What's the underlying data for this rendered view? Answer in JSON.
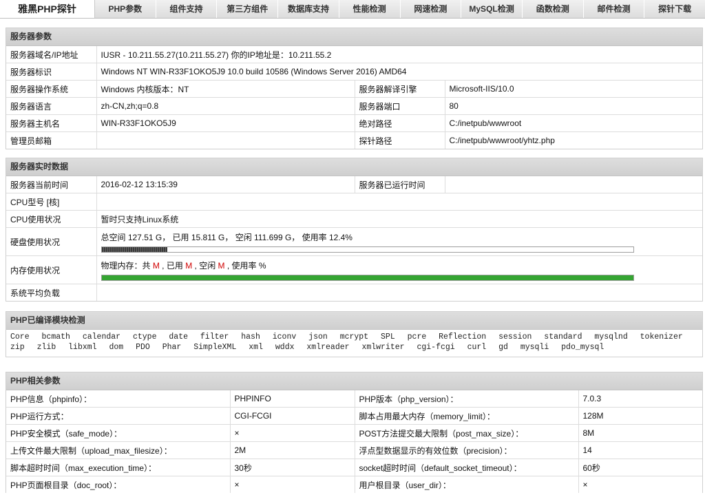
{
  "nav": {
    "brand": "雅黑PHP探针",
    "items": [
      "PHP参数",
      "组件支持",
      "第三方组件",
      "数据库支持",
      "性能检测",
      "网速检测",
      "MySQL检测",
      "函数检测",
      "邮件检测",
      "探针下载"
    ]
  },
  "server_params": {
    "title": "服务器参数",
    "domain_label": "服务器域名/IP地址",
    "domain_value": "IUSR - 10.211.55.27(10.211.55.27)  你的IP地址是：10.211.55.2",
    "id_label": "服务器标识",
    "id_value": "Windows NT WIN-R33F1OKO5J9 10.0 build 10586 (Windows Server 2016) AMD64",
    "os_label": "服务器操作系统",
    "os_value": "Windows  内核版本：NT",
    "engine_label": "服务器解译引擎",
    "engine_value": "Microsoft-IIS/10.0",
    "lang_label": "服务器语言",
    "lang_value": "zh-CN,zh;q=0.8",
    "port_label": "服务器端口",
    "port_value": "80",
    "host_label": "服务器主机名",
    "host_value": "WIN-R33F1OKO5J9",
    "abspath_label": "绝对路径",
    "abspath_value": "C:/inetpub/wwwroot",
    "admin_label": "管理员邮箱",
    "admin_value": "",
    "probe_label": "探针路径",
    "probe_value": "C:/inetpub/wwwroot/yhtz.php"
  },
  "realtime": {
    "title": "服务器实时数据",
    "time_label": "服务器当前时间",
    "time_value": "2016-02-12 13:15:39",
    "uptime_label": "服务器已运行时间",
    "uptime_value": "",
    "cpu_model_label": "CPU型号 [核]",
    "cpu_model_value": "",
    "cpu_usage_label": "CPU使用状况",
    "cpu_usage_value": "暂时只支持Linux系统",
    "disk_label": "硬盘使用状况",
    "disk_value": "总空间 127.51 G，   已用 15.811 G，   空闲 111.699 G，   使用率 12.4%",
    "disk_usage_fraction": 0.124,
    "mem_label": "内存使用状况",
    "mem_prefix": "物理内存：共 ",
    "mem_unit": "M",
    "mem_used": " , 已用 ",
    "mem_free": " , 空闲 ",
    "mem_rate": " , 使用率 %",
    "mem_usage_fraction": 1.0,
    "load_label": "系统平均负载",
    "load_value": ""
  },
  "modules": {
    "title": "PHP已编译模块检测",
    "items": [
      "Core",
      "bcmath",
      "calendar",
      "ctype",
      "date",
      "filter",
      "hash",
      "iconv",
      "json",
      "mcrypt",
      "SPL",
      "pcre",
      "Reflection",
      "session",
      "standard",
      "mysqlnd",
      "tokenizer",
      "zip",
      "zlib",
      "libxml",
      "dom",
      "PDO",
      "Phar",
      "SimpleXML",
      "xml",
      "wddx",
      "xmlreader",
      "xmlwriter",
      "cgi-fcgi",
      "curl",
      "gd",
      "mysqli",
      "pdo_mysql"
    ]
  },
  "php_params": {
    "title": "PHP相关参数",
    "rows": [
      [
        "PHP信息（phpinfo）：",
        "PHPINFO",
        "PHP版本（php_version）：",
        "7.0.3"
      ],
      [
        "PHP运行方式：",
        "CGI-FCGI",
        "脚本占用最大内存（memory_limit）：",
        "128M"
      ],
      [
        "PHP安全模式（safe_mode）：",
        "×",
        "POST方法提交最大限制（post_max_size）：",
        "8M"
      ],
      [
        "上传文件最大限制（upload_max_filesize）：",
        "2M",
        "浮点型数据显示的有效位数（precision）：",
        "14"
      ],
      [
        "脚本超时时间（max_execution_time）：",
        "30秒",
        "socket超时时间（default_socket_timeout）：",
        "60秒"
      ],
      [
        "PHP页面根目录（doc_root）：",
        "×",
        "用户根目录（user_dir）：",
        "×"
      ]
    ]
  }
}
